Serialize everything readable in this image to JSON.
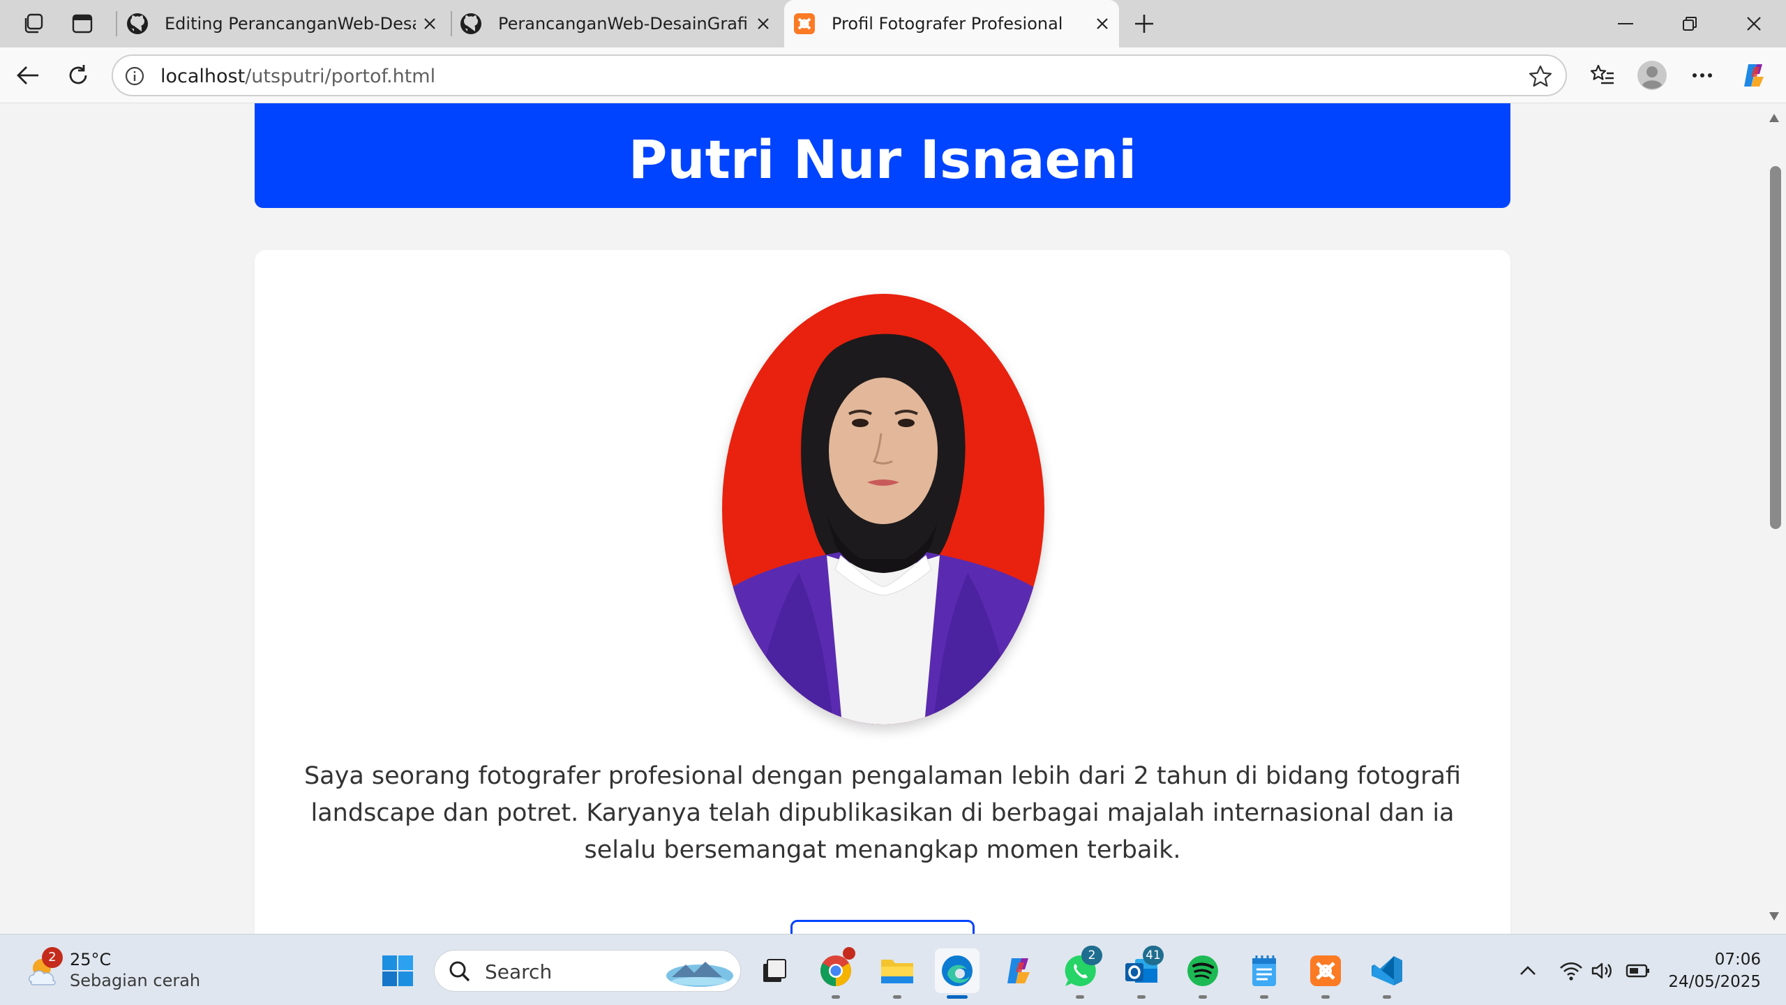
{
  "browser": {
    "tabs": [
      {
        "title": "Editing PerancanganWeb-DesainGrafis",
        "favicon": "github-icon",
        "active": false
      },
      {
        "title": "PerancanganWeb-DesainGrafis-Br",
        "favicon": "github-icon",
        "active": false
      },
      {
        "title": "Profil Fotografer Profesional",
        "favicon": "xampp-icon",
        "active": true
      }
    ],
    "address": {
      "host": "localhost",
      "path": "/utsputri/portof.html"
    }
  },
  "page": {
    "title": "Putri Nur Isnaeni",
    "bio": "Saya seorang fotografer profesional dengan pengalaman lebih dari 2 tahun di bidang fotografi landscape dan potret. Karyanya telah dipublikasikan di berbagai majalah internasional dan ia selalu bersemangat menangkap momen terbaik.",
    "colors": {
      "header": "#0044ff",
      "photo_bg": "#e8220f",
      "blazer": "#5a2bb0"
    }
  },
  "taskbar": {
    "weather": {
      "temp": "25°C",
      "condition": "Sebagian cerah",
      "badge": "2"
    },
    "search_label": "Search",
    "apps": [
      {
        "name": "windows-start",
        "badge": ""
      },
      {
        "name": "task-view",
        "badge": ""
      },
      {
        "name": "chrome",
        "badge": ""
      },
      {
        "name": "file-explorer",
        "badge": ""
      },
      {
        "name": "edge",
        "badge": ""
      },
      {
        "name": "copilot",
        "badge": ""
      },
      {
        "name": "whatsapp",
        "badge": "2"
      },
      {
        "name": "outlook",
        "badge": "41"
      },
      {
        "name": "spotify",
        "badge": ""
      },
      {
        "name": "notepad",
        "badge": ""
      },
      {
        "name": "xampp",
        "badge": ""
      },
      {
        "name": "vscode",
        "badge": ""
      }
    ],
    "clock": {
      "time": "07:06",
      "date": "24/05/2025"
    }
  }
}
